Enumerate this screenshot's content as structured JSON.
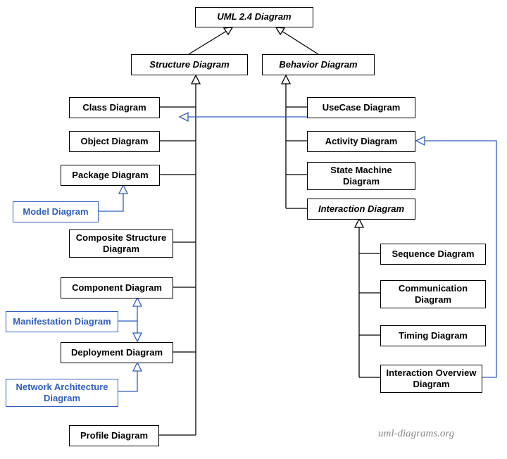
{
  "root": "UML 2.4 Diagram",
  "structure": {
    "label": "Structure Diagram",
    "children": {
      "class": "Class Diagram",
      "object": "Object Diagram",
      "package": "Package Diagram",
      "composite": "Composite Structure Diagram",
      "component": "Component Diagram",
      "deployment": "Deployment Diagram",
      "profile": "Profile Diagram"
    },
    "derived": {
      "model": "Model Diagram",
      "manifestation": "Manifestation Diagram",
      "network": "Network Architecture Diagram"
    }
  },
  "behavior": {
    "label": "Behavior Diagram",
    "children": {
      "usecase": "UseCase Diagram",
      "activity": "Activity Diagram",
      "statemachine": "State Machine Diagram",
      "interaction": {
        "label": "Interaction Diagram",
        "children": {
          "sequence": "Sequence Diagram",
          "communication": "Communication Diagram",
          "timing": "Timing Diagram",
          "overview": "Interaction Overview Diagram"
        }
      }
    }
  },
  "watermark": "uml-diagrams.org"
}
